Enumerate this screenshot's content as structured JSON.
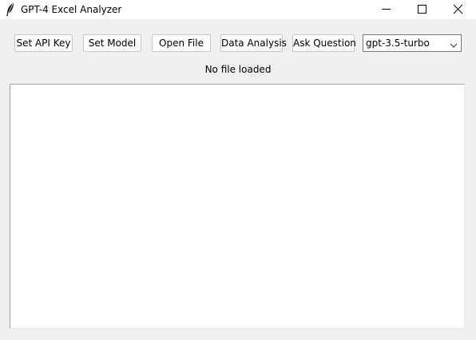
{
  "window": {
    "title": "GPT-4 Excel Analyzer",
    "icon": "feather-icon",
    "controls": [
      "minimize-icon",
      "maximize-icon",
      "close-icon"
    ]
  },
  "toolbar": {
    "set_api_key_label": "Set API Key",
    "set_model_label": "Set Model",
    "open_file_label": "Open File",
    "data_analysis_label": "Data Analysis",
    "ask_question_label": "Ask Question",
    "model_select": {
      "selected": "gpt-3.5-turbo"
    }
  },
  "status": {
    "text": "No file loaded"
  },
  "output": {
    "content": ""
  },
  "colors": {
    "window_bg": "#f0f0f0",
    "titlebar_bg": "#ffffff",
    "text_area_bg": "#ffffff"
  }
}
